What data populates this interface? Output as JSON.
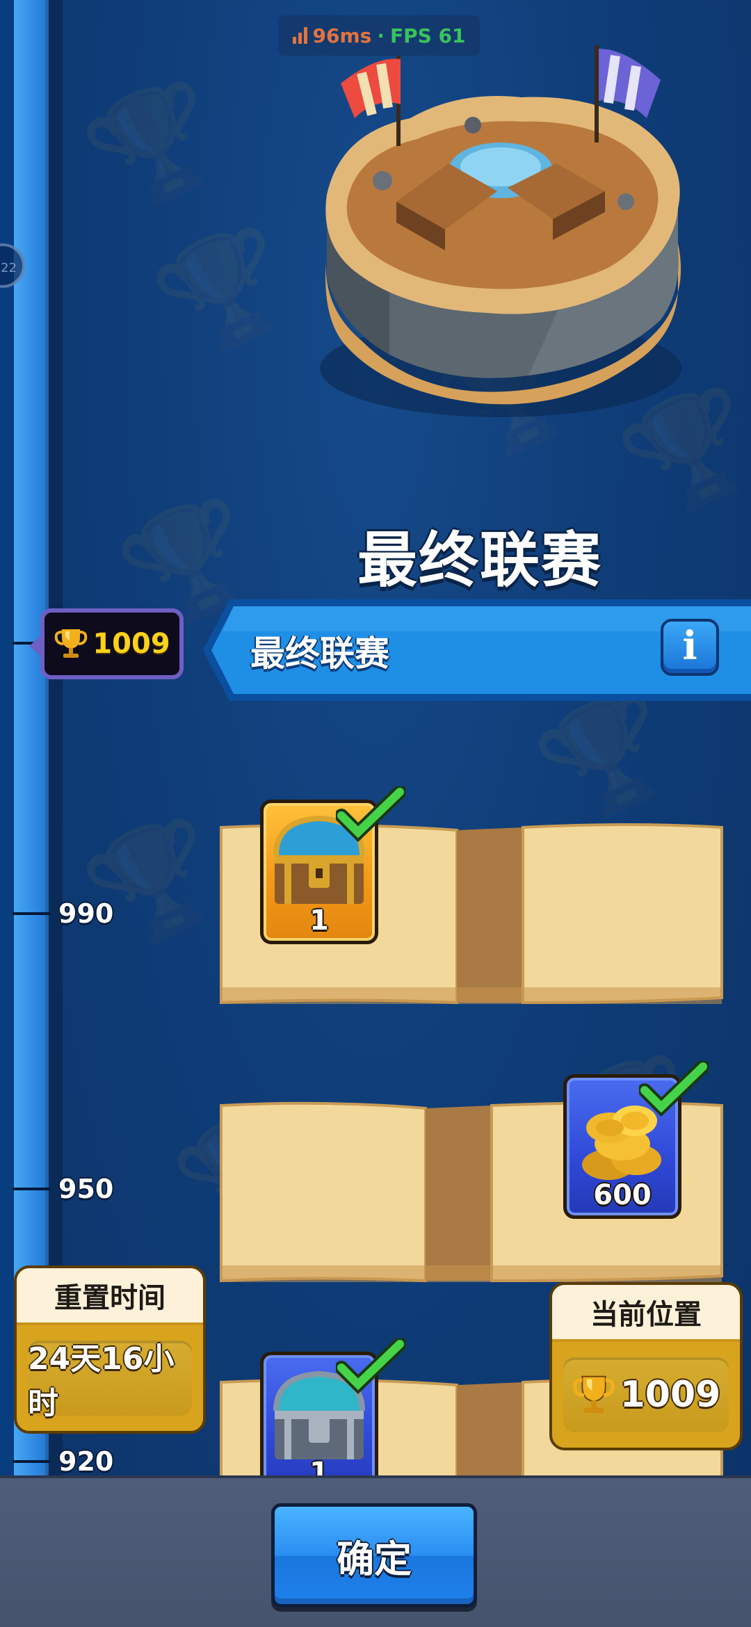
{
  "perf": {
    "latency": "96ms",
    "separator": "·",
    "fps": "FPS 61"
  },
  "arena": {
    "title": "最终联赛"
  },
  "league_banner": {
    "name": "最终联赛",
    "info_icon": "info-icon"
  },
  "current_marker": {
    "trophies": "1009",
    "icon": "trophy-icon"
  },
  "side_dial": {
    "text": "22"
  },
  "track_ticks": [
    {
      "label": "990"
    },
    {
      "label": "950"
    },
    {
      "label": "920"
    }
  ],
  "rewards": [
    {
      "item": "wooden-chest",
      "count": "1",
      "card_color": "orange",
      "claimed": true
    },
    {
      "item": "gold-coins",
      "count": "600",
      "card_color": "blue",
      "claimed": true
    },
    {
      "item": "silver-chest",
      "count": "1",
      "card_color": "blue",
      "claimed": true
    }
  ],
  "reset_panel": {
    "title": "重置时间",
    "value": "24天16小时"
  },
  "position_panel": {
    "title": "当前位置",
    "value": "1009",
    "icon": "trophy-icon"
  },
  "confirm_button": {
    "label": "确定"
  },
  "colors": {
    "background": "#0f3d78",
    "track": "#2f8ae4",
    "marker_border": "#6f5fc4",
    "trophy_text": "#ffd21a",
    "banner": "#1f8fe6",
    "parchment": "#f2d69a",
    "panel_gold": "#d9a41d",
    "confirm": "#2a8ef2",
    "check_green": "#3fcf3f"
  }
}
